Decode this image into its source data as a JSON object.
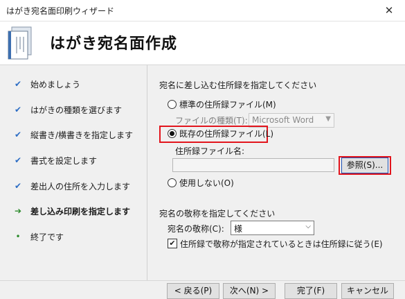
{
  "window": {
    "title": "はがき宛名面印刷ウィザード",
    "close_glyph": "✕"
  },
  "header": {
    "heading": "はがき宛名面作成"
  },
  "steps": [
    {
      "label": "始めましょう",
      "state": "done",
      "glyph": "✔"
    },
    {
      "label": "はがきの種類を選びます",
      "state": "done",
      "glyph": "✔"
    },
    {
      "label": "縦書き/横書きを指定します",
      "state": "done",
      "glyph": "✔"
    },
    {
      "label": "書式を設定します",
      "state": "done",
      "glyph": "✔"
    },
    {
      "label": "差出人の住所を入力します",
      "state": "done",
      "glyph": "✔"
    },
    {
      "label": "差し込み印刷を指定します",
      "state": "current",
      "glyph": "➔"
    },
    {
      "label": "終了です",
      "state": "todo",
      "glyph": "•"
    }
  ],
  "address_section": {
    "title": "宛名に差し込む住所録を指定してください",
    "standard": "標準の住所録ファイル(M)",
    "file_type_label": "ファイルの種類(T):",
    "file_type_value": "Microsoft Word",
    "existing": "既存の住所録ファイル(L)",
    "file_name_label": "住所録ファイル名:",
    "file_name_value": "",
    "browse": "参照(S)...",
    "none": "使用しない(O)",
    "selected": "existing"
  },
  "honorific_section": {
    "title": "宛名の敬称を指定してください",
    "label": "宛名の敬称(C):",
    "value": "様",
    "checkbox_label": "住所録で敬称が指定されているときは住所録に従う(E)",
    "checked": true
  },
  "footer": {
    "back": "< 戻る(P)",
    "next": "次へ(N) >",
    "finish": "完了(F)",
    "cancel": "キャンセル"
  },
  "colors": {
    "highlight": "#e2141c",
    "focus_blue": "#1a4fb5"
  }
}
